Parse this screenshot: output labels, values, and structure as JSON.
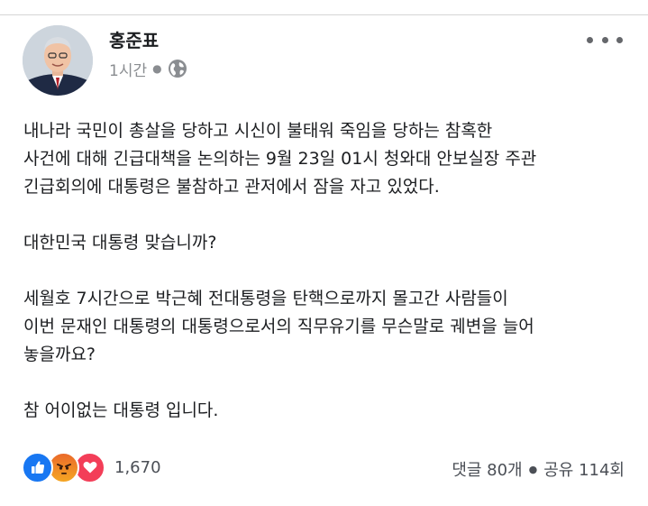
{
  "author": {
    "name": "홍준표",
    "time": "1시간"
  },
  "icons": {
    "privacy": "globe-icon",
    "more": "more-options-icon",
    "reactions": [
      "like-icon",
      "angry-icon",
      "love-icon"
    ]
  },
  "post": {
    "paragraphs": [
      "내나라 국민이 총살을 당하고 시신이 불태워 죽임을 당하는 참혹한\n 사건에 대해 긴급대책을  논의하는 9월 23일 01시 청와대 안보실장 주관\n긴급회의에 대통령은 불참하고 관저에서 잠을 자고 있었다.",
      "대한민국 대통령 맞습니까?",
      "세월호 7시간으로 박근혜 전대통령을 탄핵으로까지 몰고간 사람들이\n이번 문재인 대통령의 대통령으로서의 직무유기를 무슨말로 궤변을 늘어\n놓을까요?",
      "참 어이없는 대통령 입니다."
    ]
  },
  "footer": {
    "reaction_count": "1,670",
    "comments": "댓글 80개",
    "shares": "공유 114회"
  },
  "colors": {
    "like": "#1877f2",
    "love": "#f33e58",
    "angry": "#f08a24",
    "meta_text": "#8a8d91"
  }
}
